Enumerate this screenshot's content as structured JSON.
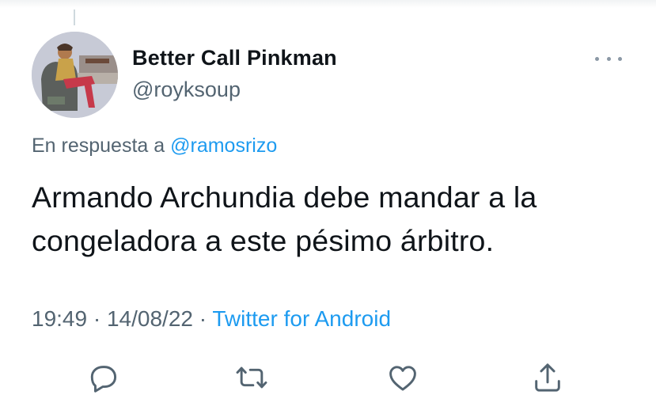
{
  "tweet": {
    "display_name": "Better Call Pinkman",
    "handle": "@royksoup",
    "reply_prefix": "En respuesta a",
    "reply_to": "@ramosrizo",
    "text": "Armando Archundia debe mandar a la congeladora a este pésimo árbitro.",
    "time": "19:49",
    "date": "14/08/22",
    "separator": "·",
    "source": "Twitter for Android"
  },
  "icons": {
    "more": "more-horizontal-icon",
    "reply": "reply-icon",
    "retweet": "retweet-icon",
    "like": "heart-icon",
    "share": "share-icon"
  },
  "colors": {
    "text": "#0f1419",
    "secondary": "#536471",
    "link": "#1d9bf0",
    "background": "#ffffff"
  }
}
